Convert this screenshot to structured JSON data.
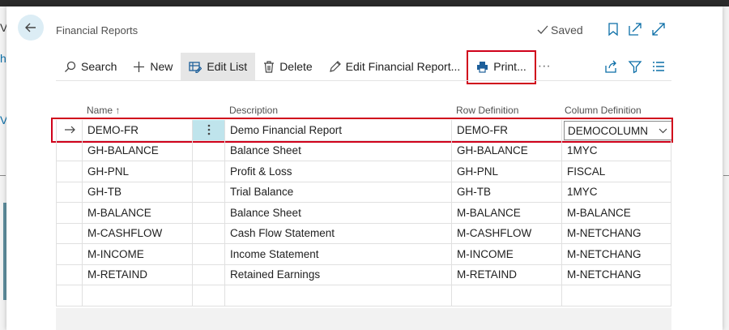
{
  "page": {
    "title": "Financial Reports",
    "status": "Saved"
  },
  "background": {
    "frag_v": "V",
    "frag_h": "h",
    "frag_v2": "V"
  },
  "actions": {
    "search": "Search",
    "new": "New",
    "edit_list": "Edit List",
    "delete": "Delete",
    "edit_report": "Edit Financial Report...",
    "print": "Print...",
    "more": "···"
  },
  "table": {
    "columns": [
      "Name ↑",
      "Description",
      "Row Definition",
      "Column Definition"
    ],
    "rows": [
      {
        "name": "DEMO-FR",
        "description": "Demo Financial Report",
        "row_def": "DEMO-FR",
        "col_def": "DEMOCOLUMN"
      },
      {
        "name": "GH-BALANCE",
        "description": "Balance Sheet",
        "row_def": "GH-BALANCE",
        "col_def": "1MYC"
      },
      {
        "name": "GH-PNL",
        "description": "Profit & Loss",
        "row_def": "GH-PNL",
        "col_def": "FISCAL"
      },
      {
        "name": "GH-TB",
        "description": "Trial Balance",
        "row_def": "GH-TB",
        "col_def": "1MYC"
      },
      {
        "name": "M-BALANCE",
        "description": "Balance Sheet",
        "row_def": "M-BALANCE",
        "col_def": "M-BALANCE"
      },
      {
        "name": "M-CASHFLOW",
        "description": "Cash Flow Statement",
        "row_def": "M-CASHFLOW",
        "col_def": "M-NETCHANG"
      },
      {
        "name": "M-INCOME",
        "description": "Income Statement",
        "row_def": "M-INCOME",
        "col_def": "M-NETCHANG"
      },
      {
        "name": "M-RETAIND",
        "description": "Retained Earnings",
        "row_def": "M-RETAIND",
        "col_def": "M-NETCHANG"
      },
      {
        "name": "",
        "description": "",
        "row_def": "",
        "col_def": ""
      }
    ]
  },
  "colors": {
    "accent": "#0b6ea7",
    "highlight": "#d0021b",
    "selected_cell": "#bfe4ec"
  }
}
